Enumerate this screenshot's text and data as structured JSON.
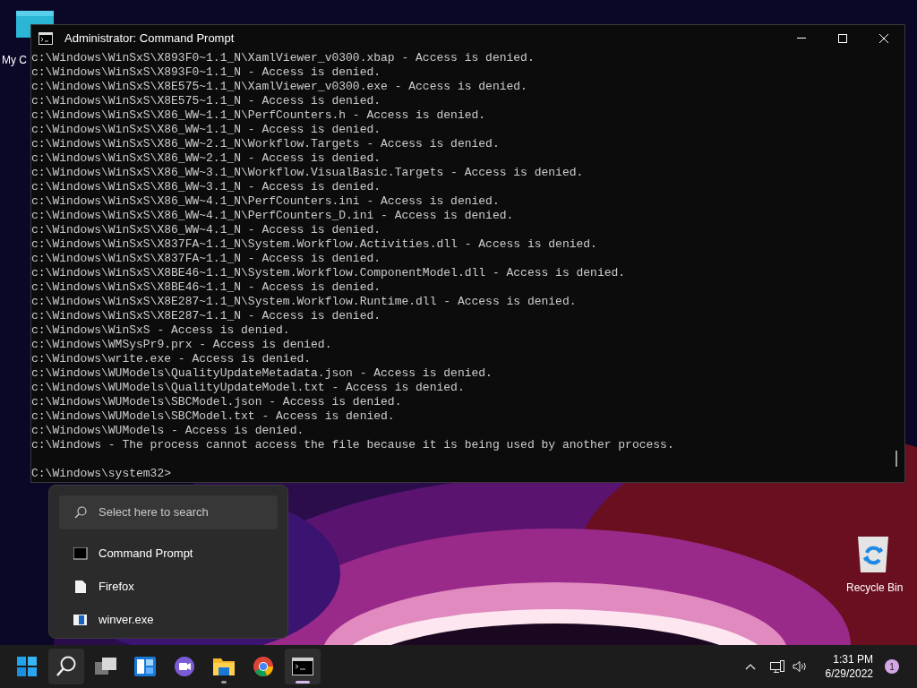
{
  "desktop_icons": [
    {
      "label": "My C",
      "kind": "computer"
    },
    {
      "label": "Recycle Bin",
      "kind": "recycle"
    }
  ],
  "window": {
    "title": "Administrator: Command Prompt",
    "console_lines": [
      "c:\\Windows\\WinSxS\\X893F0~1.1_N\\XamlViewer_v0300.xbap - Access is denied.",
      "c:\\Windows\\WinSxS\\X893F0~1.1_N - Access is denied.",
      "c:\\Windows\\WinSxS\\X8E575~1.1_N\\XamlViewer_v0300.exe - Access is denied.",
      "c:\\Windows\\WinSxS\\X8E575~1.1_N - Access is denied.",
      "c:\\Windows\\WinSxS\\X86_WW~1.1_N\\PerfCounters.h - Access is denied.",
      "c:\\Windows\\WinSxS\\X86_WW~1.1_N - Access is denied.",
      "c:\\Windows\\WinSxS\\X86_WW~2.1_N\\Workflow.Targets - Access is denied.",
      "c:\\Windows\\WinSxS\\X86_WW~2.1_N - Access is denied.",
      "c:\\Windows\\WinSxS\\X86_WW~3.1_N\\Workflow.VisualBasic.Targets - Access is denied.",
      "c:\\Windows\\WinSxS\\X86_WW~3.1_N - Access is denied.",
      "c:\\Windows\\WinSxS\\X86_WW~4.1_N\\PerfCounters.ini - Access is denied.",
      "c:\\Windows\\WinSxS\\X86_WW~4.1_N\\PerfCounters_D.ini - Access is denied.",
      "c:\\Windows\\WinSxS\\X86_WW~4.1_N - Access is denied.",
      "c:\\Windows\\WinSxS\\X837FA~1.1_N\\System.Workflow.Activities.dll - Access is denied.",
      "c:\\Windows\\WinSxS\\X837FA~1.1_N - Access is denied.",
      "c:\\Windows\\WinSxS\\X8BE46~1.1_N\\System.Workflow.ComponentModel.dll - Access is denied.",
      "c:\\Windows\\WinSxS\\X8BE46~1.1_N - Access is denied.",
      "c:\\Windows\\WinSxS\\X8E287~1.1_N\\System.Workflow.Runtime.dll - Access is denied.",
      "c:\\Windows\\WinSxS\\X8E287~1.1_N - Access is denied.",
      "c:\\Windows\\WinSxS - Access is denied.",
      "c:\\Windows\\WMSysPr9.prx - Access is denied.",
      "c:\\Windows\\write.exe - Access is denied.",
      "c:\\Windows\\WUModels\\QualityUpdateMetadata.json - Access is denied.",
      "c:\\Windows\\WUModels\\QualityUpdateModel.txt - Access is denied.",
      "c:\\Windows\\WUModels\\SBCModel.json - Access is denied.",
      "c:\\Windows\\WUModels\\SBCModel.txt - Access is denied.",
      "c:\\Windows\\WUModels - Access is denied.",
      "c:\\Windows - The process cannot access the file because it is being used by another process."
    ],
    "prompt": "C:\\Windows\\system32>"
  },
  "search_popup": {
    "placeholder": "Select here to search",
    "results": [
      {
        "label": "Command Prompt",
        "kind": "console"
      },
      {
        "label": "Firefox",
        "kind": "file"
      },
      {
        "label": "winver.exe",
        "kind": "winver"
      }
    ]
  },
  "taskbar": {
    "apps": [
      {
        "kind": "start",
        "selected": false,
        "running": false
      },
      {
        "kind": "search",
        "selected": true,
        "running": false
      },
      {
        "kind": "taskview",
        "selected": false,
        "running": false
      },
      {
        "kind": "widgets",
        "selected": false,
        "running": false
      },
      {
        "kind": "chat",
        "selected": false,
        "running": false
      },
      {
        "kind": "explorer",
        "selected": false,
        "running": true
      },
      {
        "kind": "chrome",
        "selected": false,
        "running": false
      },
      {
        "kind": "terminal",
        "selected": true,
        "running": true
      }
    ],
    "time": "1:31 PM",
    "date": "6/29/2022",
    "notification_count": "1"
  }
}
